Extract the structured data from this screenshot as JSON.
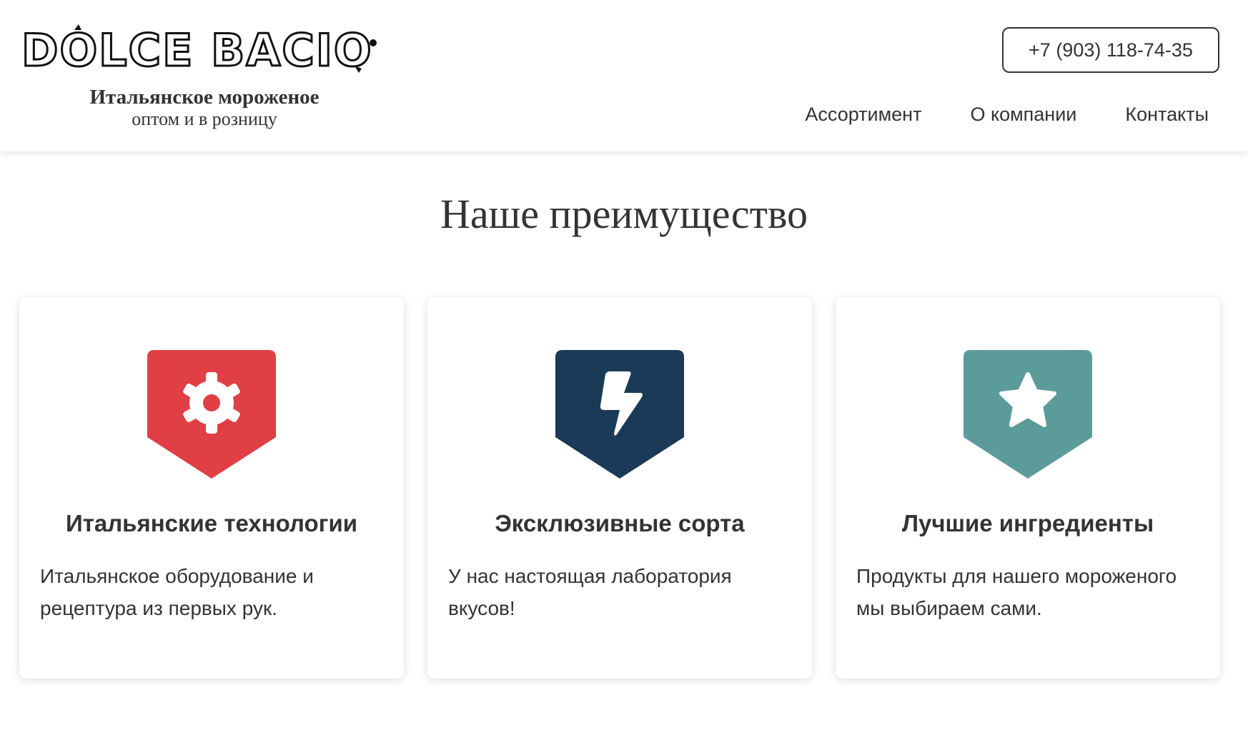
{
  "header": {
    "logo_text": "DOLCE BACIO",
    "tagline_line1": "Итальянское мороженое",
    "tagline_line2": "оптом и в розницу",
    "phone": "+7 (903) 118-74-35",
    "nav": [
      "Ассортимент",
      "О компании",
      "Контакты"
    ]
  },
  "main": {
    "title": "Наше преимущество",
    "cards": [
      {
        "icon": "gear-icon",
        "color": "#e04045",
        "title": "Итальянские технологии",
        "text": "Итальянское оборудование и рецептура из первых рук."
      },
      {
        "icon": "bolt-icon",
        "color": "#1b3a57",
        "title": "Эксклюзивные сорта",
        "text": "У нас настоящая лаборатория вкусов!"
      },
      {
        "icon": "star-icon",
        "color": "#5b9c9b",
        "title": "Лучшие ингредиенты",
        "text": "Продукты для нашего мороженого мы выбираем сами."
      }
    ]
  }
}
